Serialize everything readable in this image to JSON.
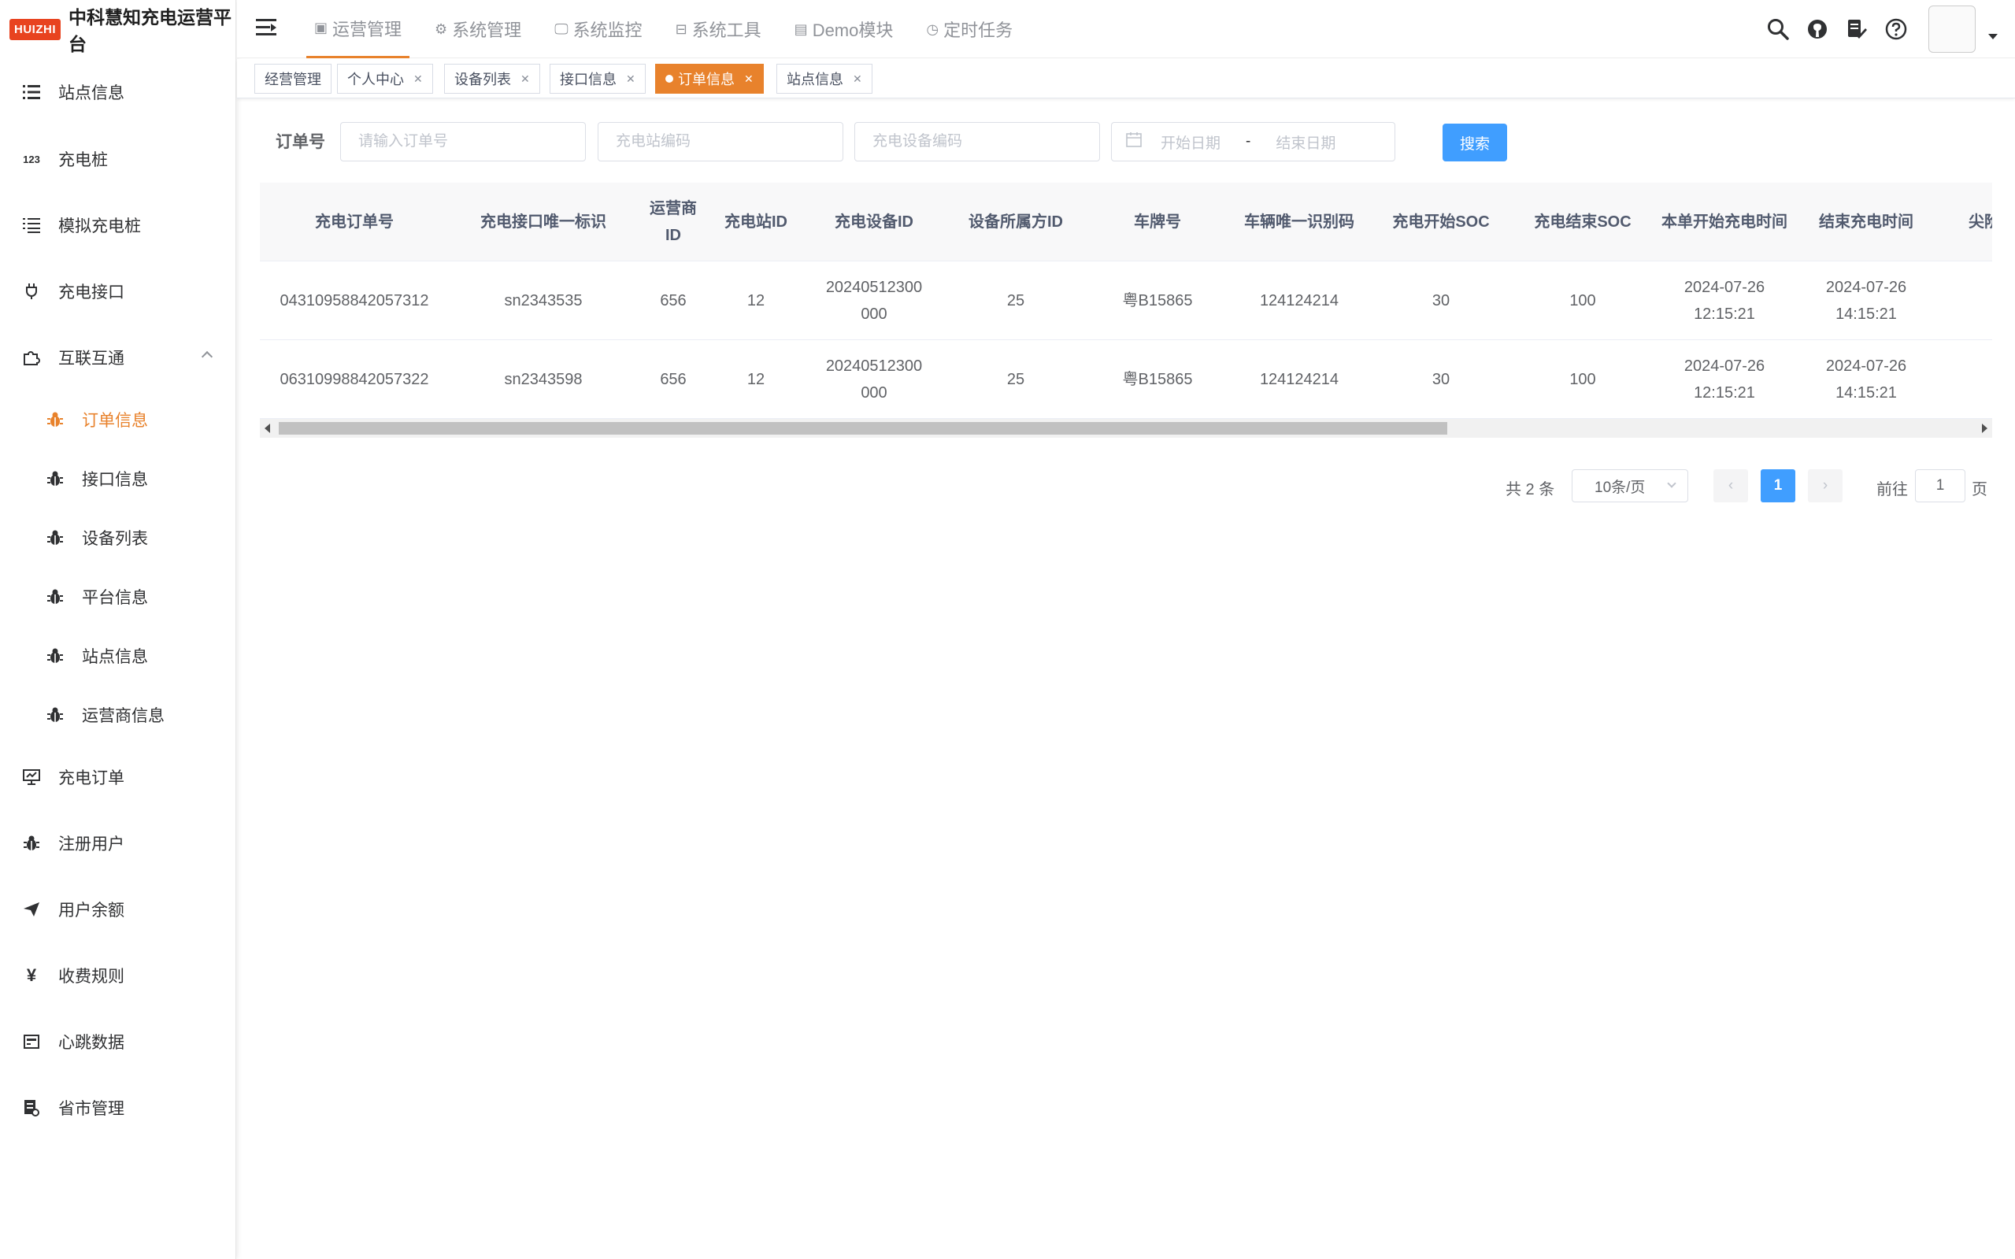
{
  "logo": {
    "badge": "HUIZHI",
    "title": "中科慧知充电运营平台"
  },
  "sidebar": {
    "items": [
      {
        "label": "站点信息",
        "icon": "list-icon"
      },
      {
        "label": "充电桩",
        "icon": "number-icon"
      },
      {
        "label": "模拟充电桩",
        "icon": "list-ordered-icon"
      },
      {
        "label": "充电接口",
        "icon": "plug-icon"
      },
      {
        "label": "互联互通",
        "icon": "puzzle-icon"
      },
      {
        "label": "充电订单",
        "icon": "monitor-icon"
      },
      {
        "label": "注册用户",
        "icon": "bug-icon"
      },
      {
        "label": "用户余额",
        "icon": "send-icon"
      },
      {
        "label": "收费规则",
        "icon": "yen-icon"
      },
      {
        "label": "心跳数据",
        "icon": "server-icon"
      },
      {
        "label": "省市管理",
        "icon": "report-icon"
      }
    ],
    "submenu": [
      {
        "label": "订单信息",
        "active": true
      },
      {
        "label": "接口信息"
      },
      {
        "label": "设备列表"
      },
      {
        "label": "平台信息"
      },
      {
        "label": "站点信息"
      },
      {
        "label": "运营商信息"
      }
    ]
  },
  "topnav": [
    {
      "label": "运营管理",
      "active": true
    },
    {
      "label": "系统管理"
    },
    {
      "label": "系统监控"
    },
    {
      "label": "系统工具"
    },
    {
      "label": "Demo模块"
    },
    {
      "label": "定时任务"
    }
  ],
  "tags": [
    {
      "label": "经营管理",
      "closable": false
    },
    {
      "label": "个人中心",
      "closable": true
    },
    {
      "label": "设备列表",
      "closable": true
    },
    {
      "label": "接口信息",
      "closable": true
    },
    {
      "label": "订单信息",
      "closable": true,
      "active": true
    },
    {
      "label": "站点信息",
      "closable": true
    }
  ],
  "search": {
    "label": "订单号",
    "order_placeholder": "请输入订单号",
    "station_placeholder": "充电站编码",
    "device_placeholder": "充电设备编码",
    "start_placeholder": "开始日期",
    "range_separator": "-",
    "end_placeholder": "结束日期",
    "button": "搜索"
  },
  "table": {
    "columns": [
      "充电订单号",
      "充电接口唯一标识",
      "运营商ID",
      "充电站ID",
      "充电设备ID",
      "设备所属方ID",
      "车牌号",
      "车辆唯一识别码",
      "充电开始SOC",
      "充电结束SOC",
      "本单开始充电时间",
      "结束充电时间",
      "尖阶"
    ],
    "rows": [
      [
        "04310958842057312",
        "sn2343535",
        "656",
        "12",
        "20240512300000",
        "25",
        "粤B15865",
        "124124214",
        "30",
        "100",
        "2024-07-26 12:15:21",
        "2024-07-26 14:15:21",
        ""
      ],
      [
        "06310998842057322",
        "sn2343598",
        "656",
        "12",
        "20240512300000",
        "25",
        "粤B15865",
        "124124214",
        "30",
        "100",
        "2024-07-26 12:15:21",
        "2024-07-26 14:15:21",
        ""
      ]
    ]
  },
  "pagination": {
    "total_text": "共 2 条",
    "page_size": "10条/页",
    "prev": "‹",
    "current": "1",
    "next": "›",
    "goto_label": "前往",
    "goto_value": "1",
    "goto_suffix": "页"
  },
  "colors": {
    "accent": "#e8822c",
    "primary": "#409eff",
    "logo": "#e8431f"
  }
}
